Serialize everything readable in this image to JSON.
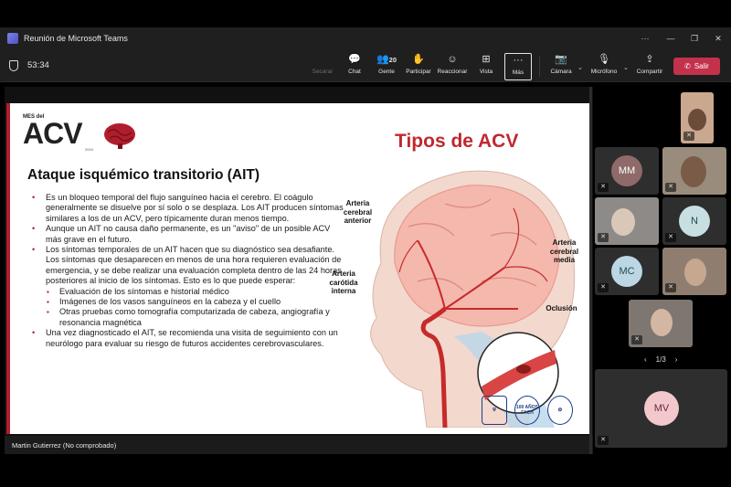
{
  "window": {
    "title": "Reunión de Microsoft Teams"
  },
  "toolbar": {
    "timer": "53:34",
    "buttons": {
      "secarar": "Secarar",
      "chat": "Chat",
      "people": "Gente",
      "people_count": "20",
      "raise": "Participar",
      "react": "Reaccionar",
      "view": "Vista",
      "more": "Más",
      "camera": "Cámara",
      "mic": "Micrófono",
      "share": "Compartir",
      "leave": "Salir"
    }
  },
  "slide": {
    "logo_mes": "MES del",
    "logo_acv": "ACV",
    "logo_year": "2024",
    "title": "Tipos de ACV",
    "heading": "Ataque isquémico transitorio (AIT)",
    "bullets": [
      "Es un bloqueo temporal del flujo sanguíneo hacia el cerebro. El coágulo generalmente se disuelve por sí solo o se desplaza. Los AIT producen síntomas similares a los de un ACV, pero típicamente duran menos tiempo.",
      "Aunque un AIT no causa daño permanente, es un \"aviso\" de un posible ACV más grave en el futuro.",
      "Los síntomas temporales de un AIT hacen que su diagnóstico sea desafiante. Los síntomas que desaparecen en menos de una hora requieren evaluación de emergencia, y se debe realizar una evaluación completa dentro de las 24 horas posteriores al inicio de los síntomas. Esto es lo que puede esperar:"
    ],
    "sub_bullets": [
      "Evaluación de los síntomas e historial médico",
      "Imágenes de los vasos sanguíneos en la cabeza y el cuello",
      "Otras pruebas como tomografía computarizada de cabeza, angiografía y resonancia magnética"
    ],
    "last_bullet": "Una vez diagnosticado el AIT, se recomienda una visita de seguimiento con un neurólogo para evaluar su riesgo de futuros accidentes cerebrovasculares.",
    "labels": {
      "aca": "Arteria cerebral anterior",
      "mca": "Arteria cerebral media",
      "ica": "Arteria carótida interna",
      "occlusion": "Oclusión"
    },
    "badge_fach": "100 AÑOS FACH"
  },
  "presenter": {
    "name": "Martin Gutierrez (No comprobado)"
  },
  "participants": {
    "initials": [
      "MM",
      "N",
      "MC",
      "MV"
    ],
    "page": "1/3"
  },
  "colors": {
    "leave": "#c4314b",
    "accent_red": "#c0282f",
    "avatar_bg": "#8e6a6a"
  }
}
